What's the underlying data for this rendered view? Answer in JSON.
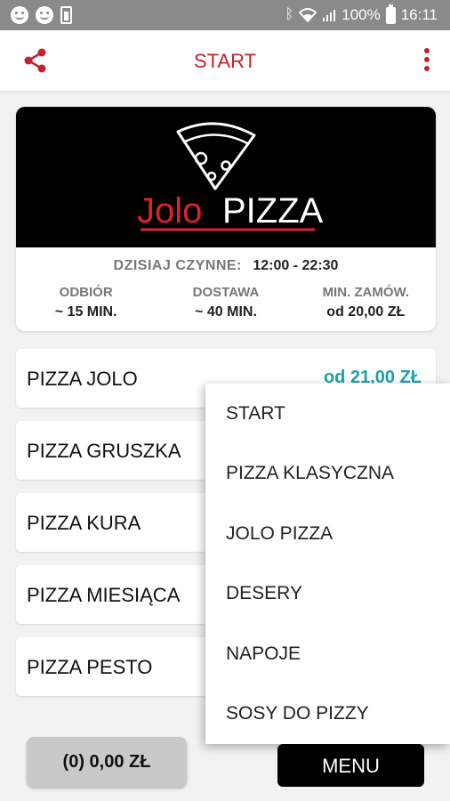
{
  "status_bar": {
    "battery": "100%",
    "time": "16:11"
  },
  "app_bar": {
    "title": "START"
  },
  "restaurant": {
    "logo_text_1": "Jolo",
    "logo_text_2": "PIZZA",
    "hours_label": "DZISIAJ CZYNNE:",
    "hours_value": "12:00 - 22:30",
    "pickup_label": "ODBIÓR",
    "pickup_value": "~ 15 MIN.",
    "delivery_label": "DOSTAWA",
    "delivery_value": "~ 40 MIN.",
    "min_order_label": "MIN. ZAMÓW.",
    "min_order_value": "od 20,00 ZŁ"
  },
  "products": [
    {
      "name": "PIZZA JOLO",
      "price": "od 21,00 ZŁ"
    },
    {
      "name": "PIZZA GRUSZKA"
    },
    {
      "name": "PIZZA KURA"
    },
    {
      "name": "PIZZA MIESIĄCA"
    },
    {
      "name": "PIZZA PESTO"
    }
  ],
  "cart": {
    "label": "(0) 0,00 ZŁ"
  },
  "menu_button": {
    "label": "MENU"
  },
  "dropdown": {
    "items": [
      "START",
      "PIZZA KLASYCZNA",
      "JOLO PIZZA",
      "DESERY",
      "NAPOJE",
      "SOSY DO PIZZY"
    ]
  },
  "colors": {
    "accent": "#c8202a",
    "price": "#1aa3ad",
    "status_bar": "#8a8a8a"
  }
}
